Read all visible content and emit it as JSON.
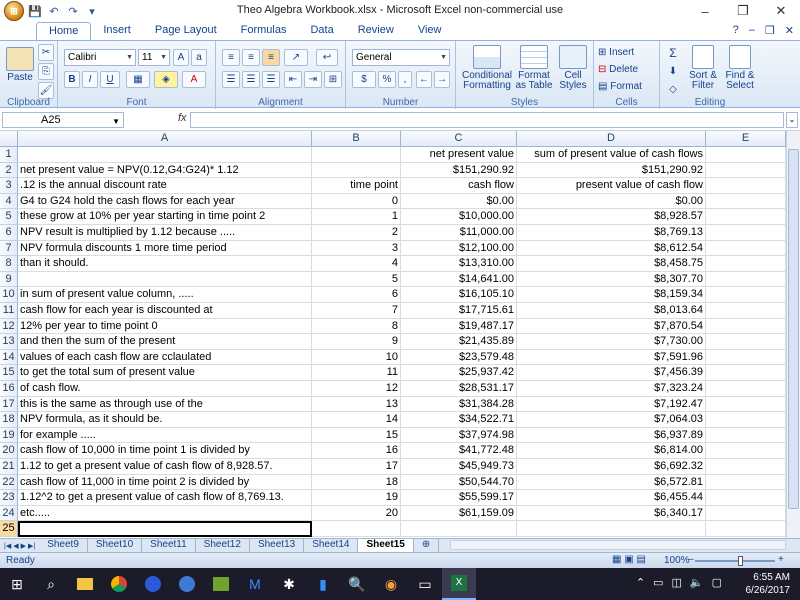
{
  "window": {
    "title": "Theo Algebra Workbook.xlsx - Microsoft Excel non-commercial use",
    "controls": [
      "–",
      "❐",
      "✕"
    ]
  },
  "quick_access": {
    "orb": "⊞",
    "save": "💾",
    "undo": "↶",
    "redo": "↷",
    "customize": "▾"
  },
  "ribbon": {
    "tabs": [
      "Home",
      "Insert",
      "Page Layout",
      "Formulas",
      "Data",
      "Review",
      "View"
    ],
    "help": "?",
    "groups": {
      "clipboard": {
        "label": "Clipboard",
        "paste": "Paste"
      },
      "font": {
        "label": "Font",
        "name": "Calibri",
        "size": "11",
        "bold": "B",
        "italic": "I",
        "underline": "U"
      },
      "alignment": {
        "label": "Alignment"
      },
      "number": {
        "label": "Number",
        "format": "General",
        "currency": "$",
        "percent": "%",
        "comma": ","
      },
      "styles": {
        "label": "Styles",
        "conditional": "Conditional Formatting",
        "table": "Format as Table",
        "cell": "Cell Styles"
      },
      "cells": {
        "label": "Cells",
        "insert": "Insert",
        "delete": "Delete",
        "format": "Format"
      },
      "editing": {
        "label": "Editing",
        "sum": "Σ",
        "sort": "Sort & Filter",
        "find": "Find & Select"
      }
    }
  },
  "formula_bar": {
    "name_box": "A25",
    "fx": "fx",
    "formula": ""
  },
  "columns": [
    "A",
    "B",
    "C",
    "D",
    "E"
  ],
  "rows": [
    {
      "n": "1",
      "a": "",
      "b": "",
      "c": "net present value",
      "d": "sum of present value of cash flows"
    },
    {
      "n": "2",
      "a": "net present value = NPV(0.12,G4:G24)* 1.12",
      "b": "",
      "c": "$151,290.92",
      "d": "$151,290.92"
    },
    {
      "n": "3",
      "a": ".12 is the annual discount rate",
      "b": "time point",
      "c": "cash flow",
      "d": "present value of cash flow"
    },
    {
      "n": "4",
      "a": "G4 to G24 hold the cash flows for each year",
      "b": "0",
      "c": "$0.00",
      "d": "$0.00"
    },
    {
      "n": "5",
      "a": "these grow at 10% per year starting in time point 2",
      "b": "1",
      "c": "$10,000.00",
      "d": "$8,928.57"
    },
    {
      "n": "6",
      "a": "NPV result is multiplied by 1.12 because .....",
      "b": "2",
      "c": "$11,000.00",
      "d": "$8,769.13"
    },
    {
      "n": "7",
      "a": "NPV formula discounts 1 more time period",
      "b": "3",
      "c": "$12,100.00",
      "d": "$8,612.54"
    },
    {
      "n": "8",
      "a": "than it should.",
      "b": "4",
      "c": "$13,310.00",
      "d": "$8,458.75"
    },
    {
      "n": "9",
      "a": "",
      "b": "5",
      "c": "$14,641.00",
      "d": "$8,307.70"
    },
    {
      "n": "10",
      "a": "in sum of present value column, .....",
      "b": "6",
      "c": "$16,105.10",
      "d": "$8,159.34"
    },
    {
      "n": "11",
      "a": "cash flow for each year is discounted at",
      "b": "7",
      "c": "$17,715.61",
      "d": "$8,013.64"
    },
    {
      "n": "12",
      "a": "12% per year to time point 0",
      "b": "8",
      "c": "$19,487.17",
      "d": "$7,870.54"
    },
    {
      "n": "13",
      "a": "and then the sum of the present",
      "b": "9",
      "c": "$21,435.89",
      "d": "$7,730.00"
    },
    {
      "n": "14",
      "a": "values of each cash flow are cclaulated",
      "b": "10",
      "c": "$23,579.48",
      "d": "$7,591.96"
    },
    {
      "n": "15",
      "a": "to get the total sum of present value",
      "b": "11",
      "c": "$25,937.42",
      "d": "$7,456.39"
    },
    {
      "n": "16",
      "a": "of cash flow.",
      "b": "12",
      "c": "$28,531.17",
      "d": "$7,323.24"
    },
    {
      "n": "17",
      "a": "this is the same as through use of the",
      "b": "13",
      "c": "$31,384.28",
      "d": "$7,192.47"
    },
    {
      "n": "18",
      "a": "NPV formula, as it should be.",
      "b": "14",
      "c": "$34,522.71",
      "d": "$7,064.03"
    },
    {
      "n": "19",
      "a": "for example .....",
      "b": "15",
      "c": "$37,974.98",
      "d": "$6,937.89"
    },
    {
      "n": "20",
      "a": "cash flow of 10,000 in time point 1 is divided by",
      "b": "16",
      "c": "$41,772.48",
      "d": "$6,814.00"
    },
    {
      "n": "21",
      "a": "1.12 to get a present value of cash flow of 8,928.57.",
      "b": "17",
      "c": "$45,949.73",
      "d": "$6,692.32"
    },
    {
      "n": "22",
      "a": "cash flow of 11,000 in time point 2 is divided by",
      "b": "18",
      "c": "$50,544.70",
      "d": "$6,572.81"
    },
    {
      "n": "23",
      "a": "1.12^2 to get a present value of cash flow of 8,769.13.",
      "b": "19",
      "c": "$55,599.17",
      "d": "$6,455.44"
    },
    {
      "n": "24",
      "a": "etc.....",
      "b": "20",
      "c": "$61,159.09",
      "d": "$6,340.17"
    },
    {
      "n": "25",
      "a": "",
      "b": "",
      "c": "",
      "d": ""
    }
  ],
  "sheet_tabs": [
    "Sheet9",
    "Sheet10",
    "Sheet11",
    "Sheet12",
    "Sheet13",
    "Sheet14",
    "Sheet15"
  ],
  "active_sheet": "Sheet15",
  "status": {
    "mode": "Ready",
    "zoom": "100%",
    "zoom_minus": "–",
    "zoom_plus": "+"
  },
  "taskbar": {
    "time": "6:55 AM",
    "date": "6/26/2017",
    "start": "⊞",
    "search": "⌕"
  }
}
